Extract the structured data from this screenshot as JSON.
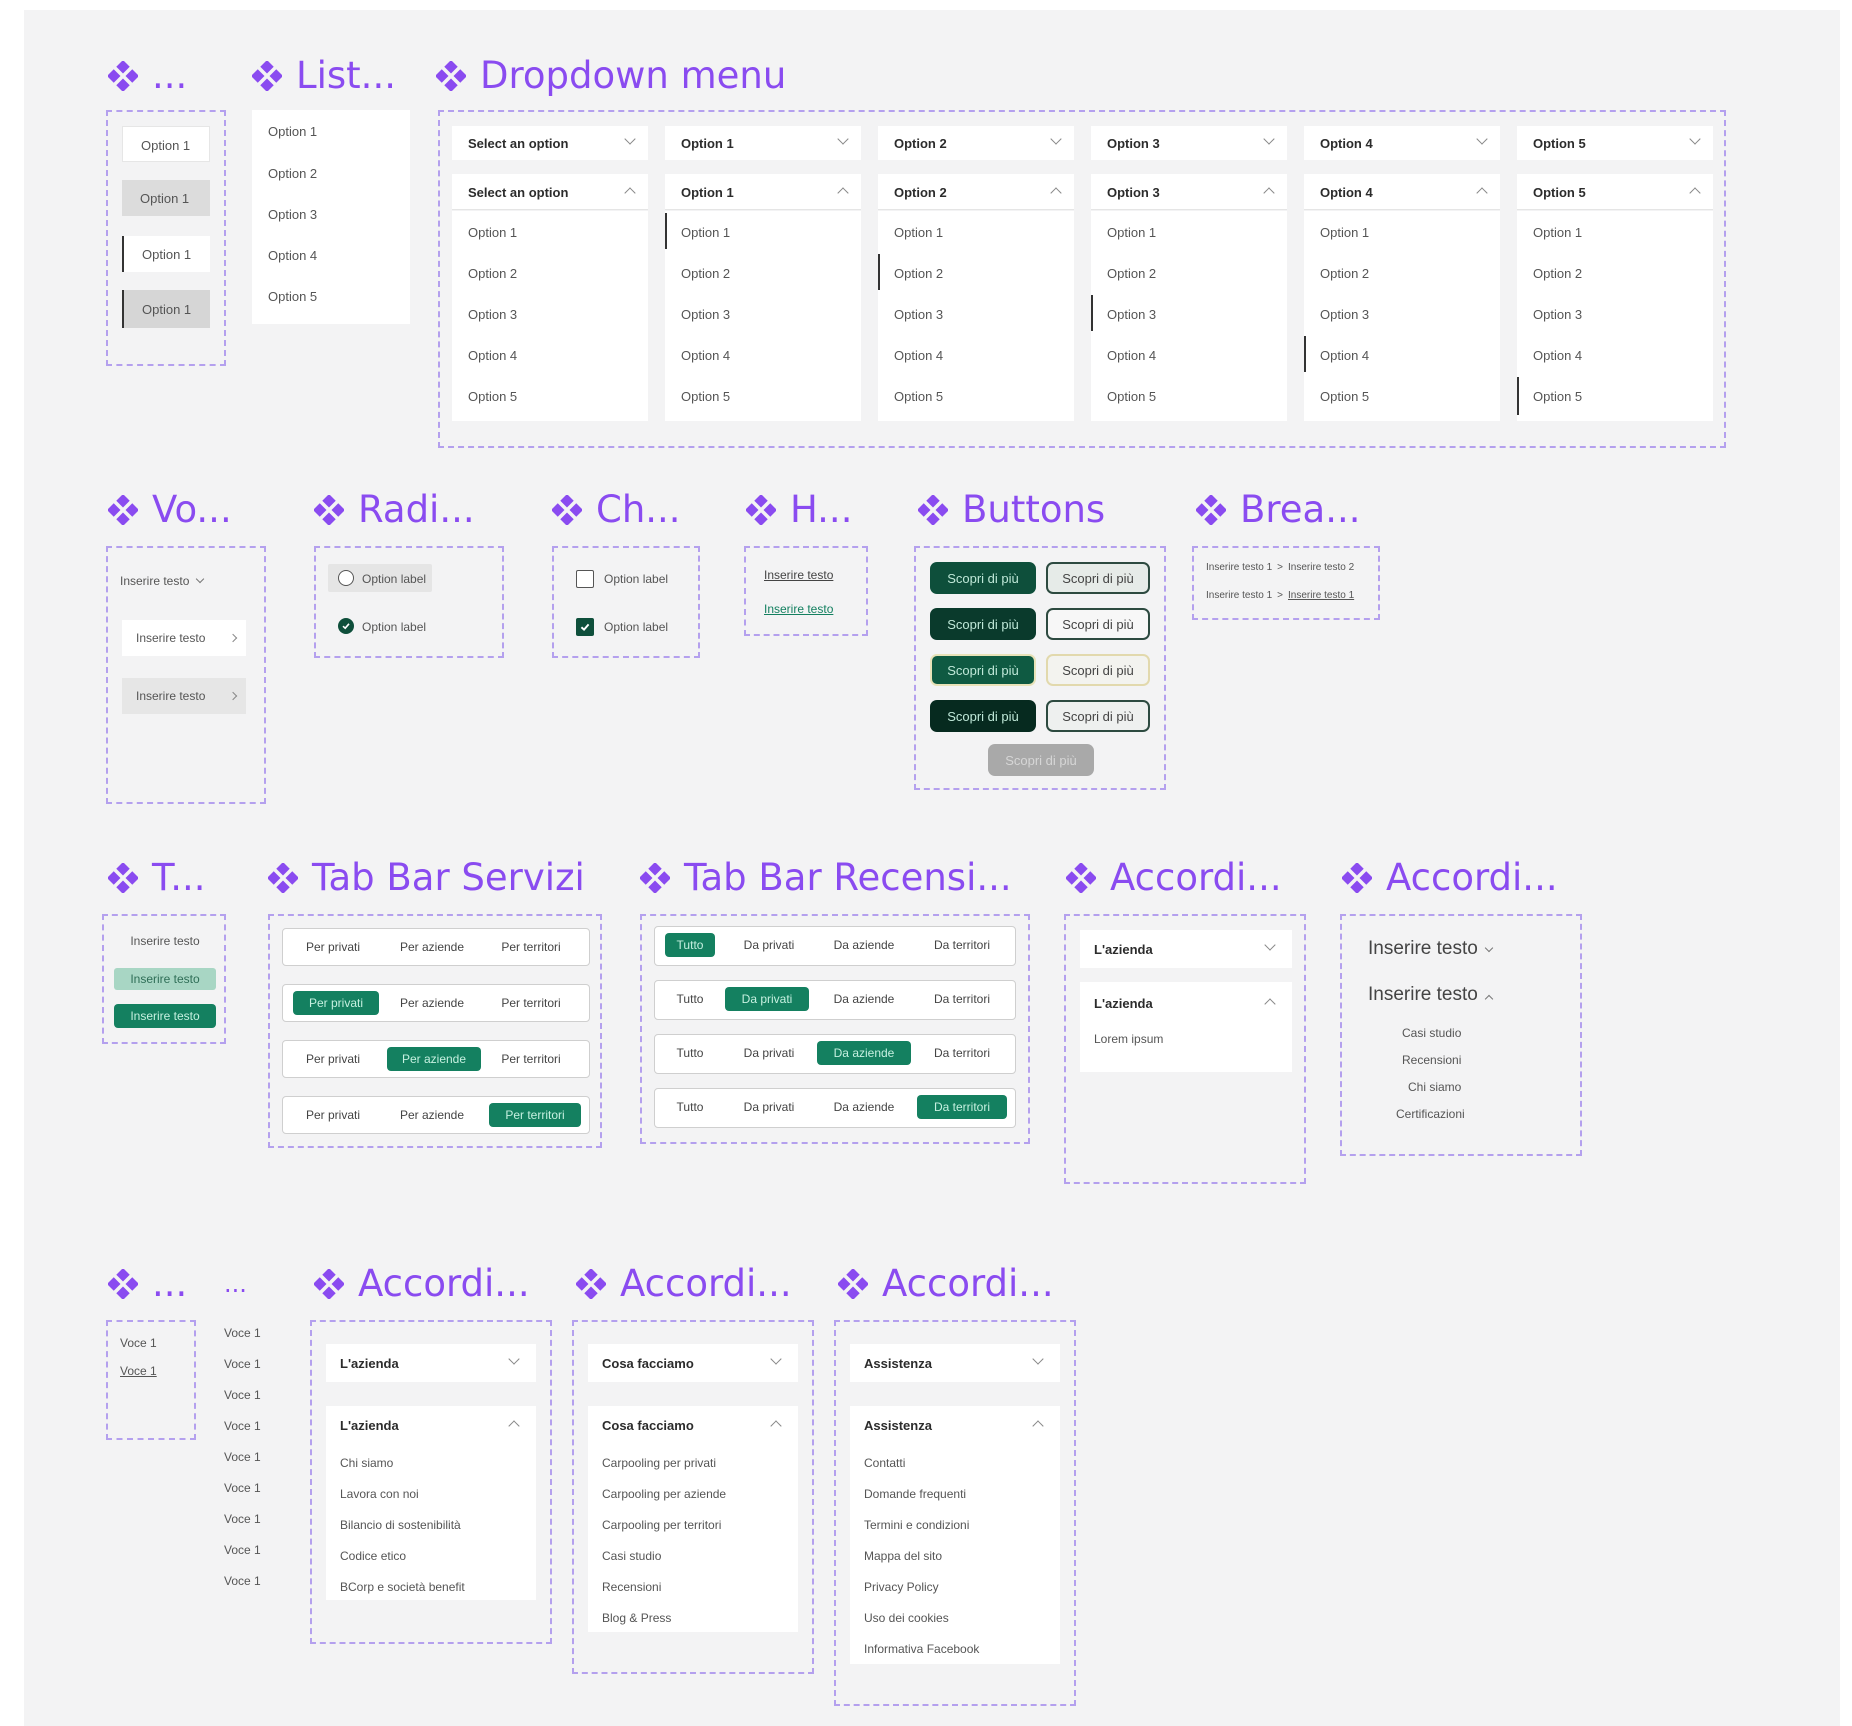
{
  "colors": {
    "accent_purple": "#8a4bf0",
    "green": "#148060",
    "dark_green": "#0e4f3b",
    "frame_border": "#b4a0ee",
    "background": "#f3f3f4"
  },
  "titles": {
    "item": "...",
    "list": "List...",
    "dropdown": "Dropdown menu",
    "voice": "Vo...",
    "radio": "Radi...",
    "checkbox": "Ch...",
    "hyperlink": "H...",
    "buttons": "Buttons",
    "breadcrumb": "Brea...",
    "tag": "T...",
    "tab_servizi": "Tab Bar Servizi",
    "tab_recensioni": "Tab Bar Recensi...",
    "accordion_a": "Accordi...",
    "accordion_b": "Accordi...",
    "link_small": "...",
    "link_dots": "...",
    "accordion_c": "Accordi...",
    "accordion_d": "Accordi...",
    "accordion_e": "Accordi..."
  },
  "item_states": [
    "Option 1",
    "Option 1",
    "Option 1",
    "Option 1"
  ],
  "list": [
    "Option 1",
    "Option 2",
    "Option 3",
    "Option 4",
    "Option 5"
  ],
  "dropdowns": [
    {
      "label": "Select an option",
      "options": [
        "Option 1",
        "Option 2",
        "Option 3",
        "Option 4",
        "Option 5"
      ]
    },
    {
      "label": "Option 1",
      "options": [
        "Option 1",
        "Option 2",
        "Option 3",
        "Option 4",
        "Option 5"
      ]
    },
    {
      "label": "Option 2",
      "options": [
        "Option 1",
        "Option 2",
        "Option 3",
        "Option 4",
        "Option 5"
      ]
    },
    {
      "label": "Option 3",
      "options": [
        "Option 1",
        "Option 2",
        "Option 3",
        "Option 4",
        "Option 5"
      ]
    },
    {
      "label": "Option 4",
      "options": [
        "Option 1",
        "Option 2",
        "Option 3",
        "Option 4",
        "Option 5"
      ]
    },
    {
      "label": "Option 5",
      "options": [
        "Option 1",
        "Option 2",
        "Option 3",
        "Option 4",
        "Option 5"
      ]
    }
  ],
  "voice": {
    "menu": "Inserire testo",
    "items": [
      "Inserire testo",
      "Inserire testo"
    ]
  },
  "radio": {
    "label": "Option label"
  },
  "checkbox": {
    "label": "Option label"
  },
  "hyperlink": [
    "Inserire testo",
    "Inserire testo"
  ],
  "buttons": {
    "primary": "Scopri di più",
    "secondary": "Scopri di più",
    "disabled": "Scopri di più"
  },
  "breadcrumb": {
    "first": "Inserire testo 1",
    "second": "Inserire testo 2",
    "first_b": "Inserire testo 1",
    "second_b": "Inserire testo 1"
  },
  "tags": [
    "Inserire testo",
    "Inserire testo",
    "Inserire testo"
  ],
  "tab_servizi": [
    "Per privati",
    "Per aziende",
    "Per territori"
  ],
  "tab_recensioni": [
    "Tutto",
    "Da privati",
    "Da aziende",
    "Da territori"
  ],
  "accordion_a": {
    "title": "L'azienda",
    "body": "Lorem ipsum"
  },
  "accordion_b": {
    "items": [
      "Inserire testo",
      "Inserire testo"
    ],
    "sub": [
      "Casi studio",
      "Recensioni",
      "Chi siamo",
      "Certificazioni"
    ]
  },
  "link_small": [
    "Voce 1",
    "Voce 1"
  ],
  "link_dots": [
    "Voce 1",
    "Voce 1",
    "Voce 1",
    "Voce 1",
    "Voce 1",
    "Voce 1",
    "Voce 1",
    "Voce 1",
    "Voce 1"
  ],
  "accordion_c": {
    "title": "L'azienda",
    "items": [
      "Chi siamo",
      "Lavora con noi",
      "Bilancio di sostenibilità",
      "Codice etico",
      "BCorp e società benefit"
    ]
  },
  "accordion_d": {
    "title": "Cosa facciamo",
    "items": [
      "Carpooling per privati",
      "Carpooling per aziende",
      "Carpooling per territori",
      "Casi studio",
      "Recensioni",
      "Blog & Press"
    ]
  },
  "accordion_e": {
    "title": "Assistenza",
    "items": [
      "Contatti",
      "Domande frequenti",
      "Termini e condizioni",
      "Mappa del sito",
      "Privacy Policy",
      "Uso dei cookies",
      "Informativa Facebook"
    ]
  }
}
